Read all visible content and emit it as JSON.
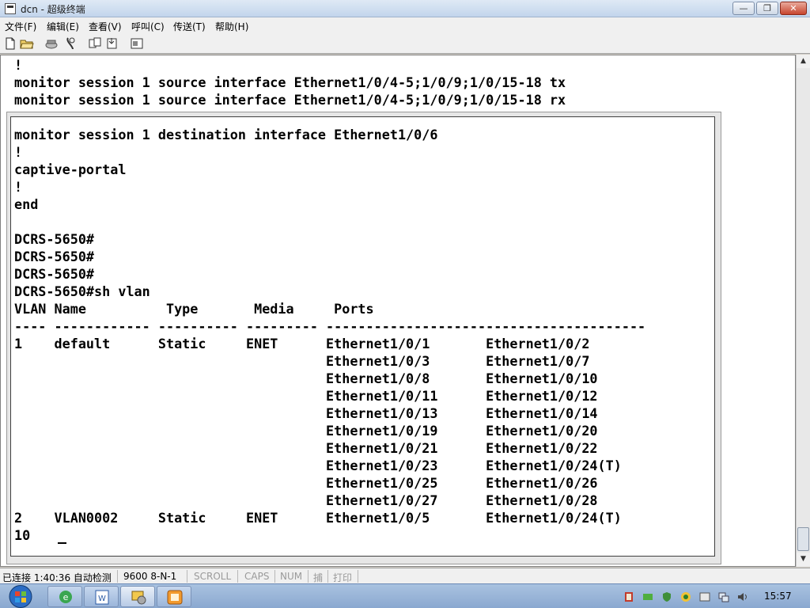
{
  "window": {
    "title": "dcn - 超级终端",
    "minimize_label": "—",
    "maximize_label": "❐",
    "close_label": "✕"
  },
  "menu": [
    "文件(F)",
    "编辑(E)",
    "查看(V)",
    "呼叫(C)",
    "传送(T)",
    "帮助(H)"
  ],
  "toolbar": [
    "new-icon",
    "open-icon",
    "dial-icon",
    "disconnect-icon",
    "send-icon",
    "receive-icon",
    "properties-icon"
  ],
  "terminal": {
    "back_lines": [
      "!",
      "monitor session 1 source interface Ethernet1/0/4-5;1/0/9;1/0/15-18 tx",
      "monitor session 1 source interface Ethernet1/0/4-5;1/0/9;1/0/15-18 rx"
    ],
    "lines": [
      "monitor session 1 destination interface Ethernet1/0/6",
      "!",
      "captive-portal",
      "!",
      "end",
      "",
      "DCRS-5650#",
      "DCRS-5650#",
      "DCRS-5650#",
      "DCRS-5650#sh vlan",
      "VLAN Name          Type       Media     Ports",
      "---- ------------ ---------- --------- ----------------------------------------",
      "1    default      Static     ENET      Ethernet1/0/1       Ethernet1/0/2",
      "                                       Ethernet1/0/3       Ethernet1/0/7",
      "                                       Ethernet1/0/8       Ethernet1/0/10",
      "                                       Ethernet1/0/11      Ethernet1/0/12",
      "                                       Ethernet1/0/13      Ethernet1/0/14",
      "                                       Ethernet1/0/19      Ethernet1/0/20",
      "                                       Ethernet1/0/21      Ethernet1/0/22",
      "                                       Ethernet1/0/23      Ethernet1/0/24(T)",
      "                                       Ethernet1/0/25      Ethernet1/0/26",
      "                                       Ethernet1/0/27      Ethernet1/0/28",
      "2    VLAN0002     Static     ENET      Ethernet1/0/5       Ethernet1/0/24(T)",
      "10"
    ]
  },
  "status": {
    "connected": "已连接 1:40:36 自动检测",
    "settings": "9600 8-N-1",
    "scroll": "SCROLL",
    "caps": "CAPS",
    "num": "NUM",
    "capture": "捕",
    "print": "打印"
  },
  "taskbar": {
    "clock": "15:57"
  },
  "colors": {
    "terminal_bg": "#ffffff",
    "terminal_fg": "#000000",
    "taskbar": "#9bb6da"
  }
}
